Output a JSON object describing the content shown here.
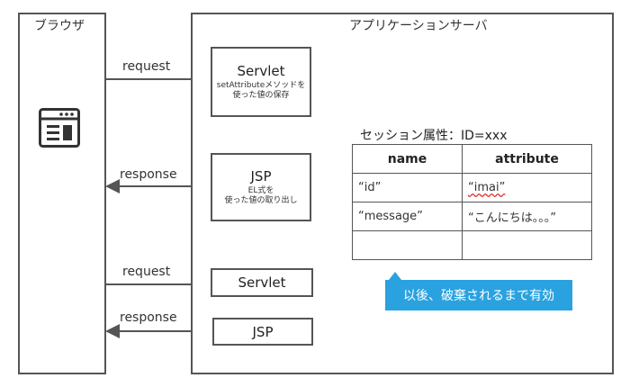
{
  "browser": {
    "title": "ブラウザ",
    "icon": "browser-window-icon"
  },
  "server": {
    "title": "アプリケーションサーバ"
  },
  "flows": [
    {
      "request_label": "request",
      "response_label": "response",
      "servlet": {
        "title": "Servlet",
        "subtitle": "setAttributeメソッドを\n使った値の保存"
      },
      "jsp": {
        "title": "JSP",
        "subtitle": "EL式を\n使った値の取り出し"
      }
    },
    {
      "request_label": "request",
      "response_label": "response",
      "servlet": {
        "title": "Servlet"
      },
      "jsp": {
        "title": "JSP"
      }
    }
  ],
  "session": {
    "title": "セッション属性：ID=xxx",
    "headers": [
      "name",
      "attribute"
    ],
    "rows": [
      [
        "“id”",
        "“imai”"
      ],
      [
        "“message”",
        "“こんにちは。。。”"
      ],
      [
        "",
        ""
      ]
    ]
  },
  "callout": {
    "text": "以後、破棄されるまで有効",
    "color": "#2aa2e0"
  }
}
